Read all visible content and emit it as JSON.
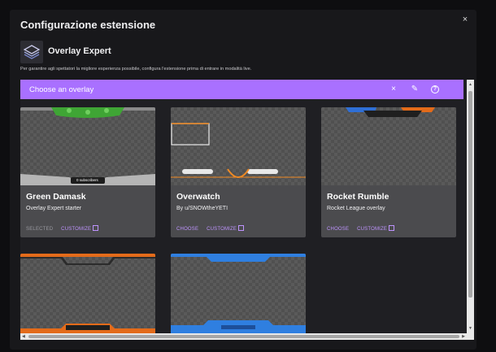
{
  "modal": {
    "title": "Configurazione estensione",
    "close_label": "×"
  },
  "extension": {
    "name": "Overlay Expert",
    "description": "Per garantire agli spettatori la migliore esperienza possibile, configura l'estensione prima di entrare in modalità live."
  },
  "chooser": {
    "title": "Choose an overlay",
    "close_icon": "×",
    "edit_icon": "✎",
    "help_icon": "?"
  },
  "overlays": [
    {
      "name": "Green Damask",
      "subtitle": "Overlay Expert starter",
      "status": "SELECTED",
      "customize": "CUSTOMIZE",
      "thumb_label": "0 subscribers"
    },
    {
      "name": "Overwatch",
      "subtitle": "By u/SNOWtheYETI",
      "choose": "CHOOSE",
      "customize": "CUSTOMIZE"
    },
    {
      "name": "Rocket Rumble",
      "subtitle": "Rocket League overlay",
      "choose": "CHOOSE",
      "customize": "CUSTOMIZE"
    }
  ],
  "colors": {
    "accent": "#a970ff",
    "link": "#bf94ff",
    "card_bg": "#4b4b4e",
    "panel_bg": "#18181b"
  }
}
